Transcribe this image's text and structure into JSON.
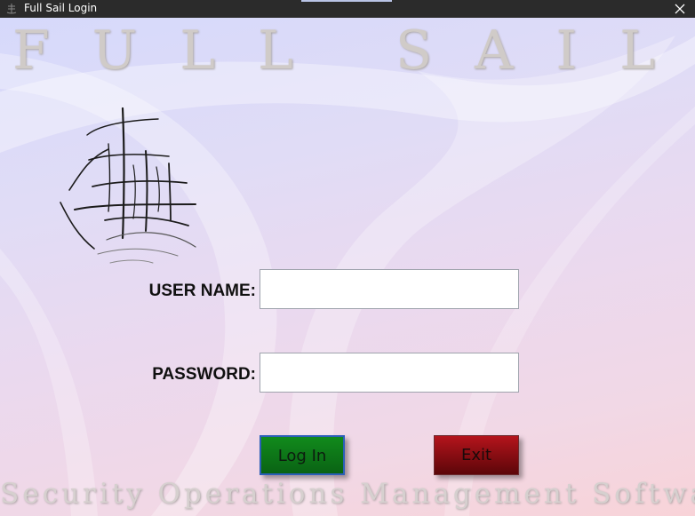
{
  "window": {
    "title": "Full Sail Login",
    "app_icon": "ship-icon",
    "close_icon": "close-icon"
  },
  "branding": {
    "title": "FULL SAIL",
    "tagline": "Security Operations Management Software",
    "logo": "sailing-ship-logo"
  },
  "form": {
    "username_label": "USER NAME:",
    "username_value": "",
    "password_label": "PASSWORD:",
    "password_value": ""
  },
  "buttons": {
    "login_label": "Log In",
    "exit_label": "Exit"
  },
  "colors": {
    "titlebar": "#2b2b2b",
    "login_button": "#0d7a17",
    "exit_button": "#8e0e13",
    "background_top": "#d6d9fb",
    "background_bottom": "#f8d3d8"
  }
}
